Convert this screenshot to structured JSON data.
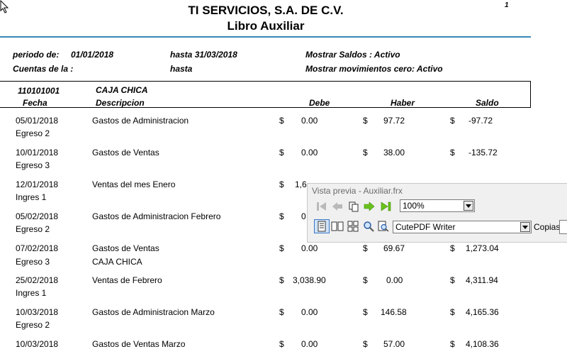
{
  "report": {
    "company": "TI SERVICIOS, S.A. DE C.V.",
    "subtitle": "Libro Auxiliar",
    "page_number": "1"
  },
  "filters": {
    "periodo_label": "periodo de:",
    "periodo_from": "01/01/2018",
    "hasta_label": "hasta",
    "periodo_to": "31/03/2018",
    "cuentas_label": "Cuentas de la :",
    "cuentas_hasta_label": "hasta",
    "mostrar_saldos": "Mostrar Saldos : Activo",
    "mostrar_mov_cero": "Mostrar movimientos cero: Activo"
  },
  "account": {
    "code": "110101001",
    "name": "CAJA CHICA"
  },
  "columns": {
    "fecha": "Fecha",
    "descripcion": "Descripcion",
    "debe": "Debe",
    "haber": "Haber",
    "saldo": "Saldo"
  },
  "currency_symbol": "$",
  "rows": [
    {
      "fecha": "05/01/2018",
      "tipo": "Egreso 2",
      "descripcion": "Gastos de Administracion",
      "extra": "",
      "debe": "0.00",
      "haber": "97.72",
      "saldo": "-97.72"
    },
    {
      "fecha": "10/01/2018",
      "tipo": "Egreso 3",
      "descripcion": "Gastos de Ventas",
      "extra": "",
      "debe": "0.00",
      "haber": "38.00",
      "saldo": "-135.72"
    },
    {
      "fecha": "12/01/2018",
      "tipo": "Ingres 1",
      "descripcion": "Ventas del mes Enero",
      "extra": "",
      "debe": "1,6",
      "haber": "",
      "saldo": ""
    },
    {
      "fecha": "05/02/2018",
      "tipo": "Egreso 2",
      "descripcion": "Gastos de Administracion Febrero",
      "extra": "",
      "debe": "0",
      "haber": "",
      "saldo": ""
    },
    {
      "fecha": "07/02/2018",
      "tipo": "Egreso 3",
      "descripcion": "Gastos de Ventas",
      "extra": "CAJA CHICA",
      "debe": "0.00",
      "haber": "69.67",
      "saldo": "1,273.04"
    },
    {
      "fecha": "25/02/2018",
      "tipo": "Ingres 1",
      "descripcion": "Ventas de Febrero",
      "extra": "",
      "debe": "3,038.90",
      "haber": "0.00",
      "saldo": "4,311.94"
    },
    {
      "fecha": "10/03/2018",
      "tipo": "Egreso 2",
      "descripcion": "Gastos de Administracion Marzo",
      "extra": "",
      "debe": "0.00",
      "haber": "146.58",
      "saldo": "4,165.36"
    },
    {
      "fecha": "10/03/2018",
      "tipo": "",
      "descripcion": "Gastos de Ventas Marzo",
      "extra": "",
      "debe": "0.00",
      "haber": "57.00",
      "saldo": "4,108.36"
    }
  ],
  "preview_toolbar": {
    "title": "Vista previa - Auxiliar.frx",
    "zoom": "100%",
    "printer": "CutePDF Writer",
    "copies_label": "Copias",
    "copies_value": "",
    "icons": [
      "first-page-icon",
      "previous-page-icon",
      "copy-pages-icon",
      "next-page-icon",
      "last-page-icon",
      "one-page-icon",
      "two-pages-icon",
      "multi-page-icon",
      "zoom-icon",
      "zoom-page-icon"
    ]
  }
}
